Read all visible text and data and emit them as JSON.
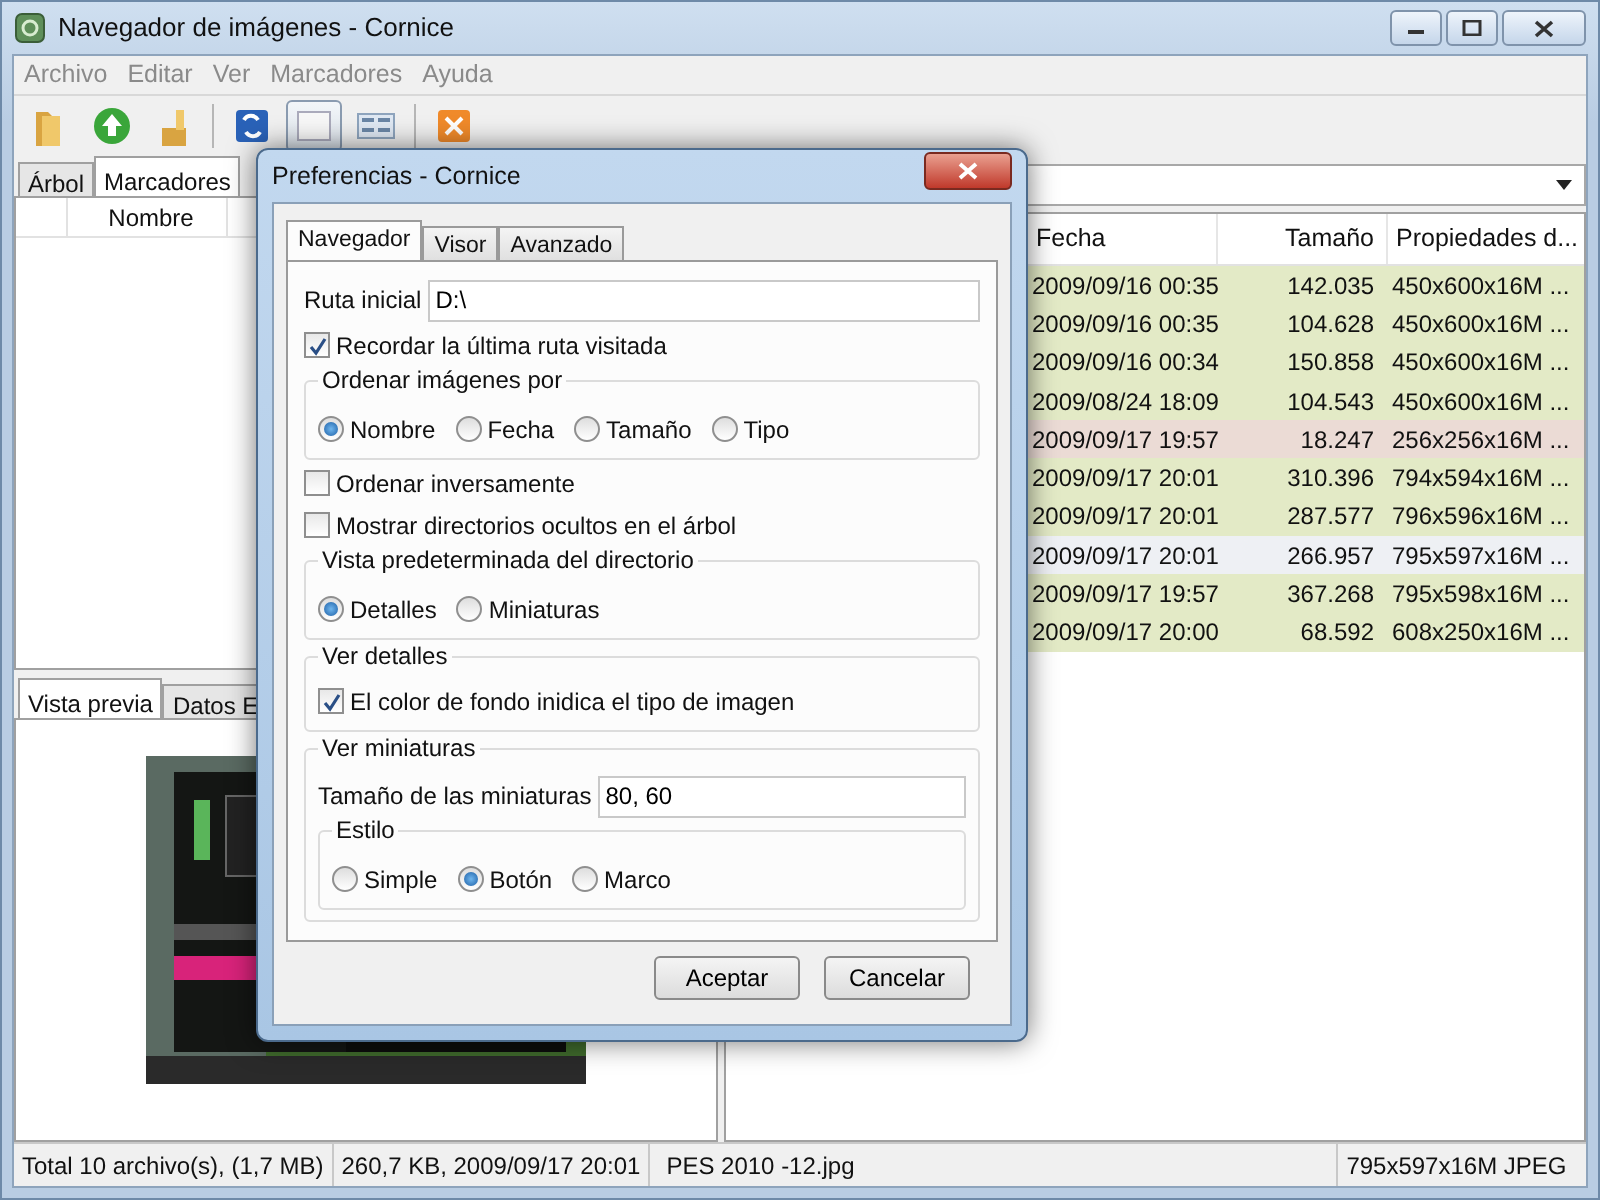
{
  "window": {
    "title": "Navegador de imágenes - Cornice"
  },
  "menu": [
    "Archivo",
    "Editar",
    "Ver",
    "Marcadores",
    "Ayuda"
  ],
  "toolbar": [
    {
      "pressed": false
    },
    {
      "pressed": false
    },
    {
      "pressed": false
    },
    {
      "pressed": false
    },
    {
      "pressed": true
    },
    {
      "pressed": false
    },
    {
      "pressed": false
    }
  ],
  "left_panel": {
    "tabs": [
      {
        "label": "Árbol",
        "selected": false
      },
      {
        "label": "Marcadores",
        "selected": true
      }
    ],
    "columns": [
      "Nombre"
    ]
  },
  "preview_panel": {
    "tabs": [
      {
        "label": "Vista previa",
        "selected": true
      },
      {
        "label": "Datos E",
        "selected": false
      }
    ]
  },
  "file_list": {
    "columns": [
      "Fecha",
      "Tamaño",
      "Propiedades d..."
    ],
    "rows": [
      {
        "cells": [
          "2009/09/16 00:35",
          "142.035",
          "450x600x16M ..."
        ],
        "color": "#e3eac6",
        "selected": false
      },
      {
        "cells": [
          "2009/09/16 00:35",
          "104.628",
          "450x600x16M ..."
        ],
        "color": "#e3eac6",
        "selected": false
      },
      {
        "cells": [
          "2009/09/16 00:34",
          "150.858",
          "450x600x16M ..."
        ],
        "color": "#e3eac6",
        "selected": false
      },
      {
        "cells": [
          "2009/08/24 18:09",
          "104.543",
          "450x600x16M ..."
        ],
        "color": "#e3eac6",
        "selected": false
      },
      {
        "cells": [
          "2009/09/17 19:57",
          "18.247",
          "256x256x16M ..."
        ],
        "color": "#ebdbd5",
        "selected": false
      },
      {
        "cells": [
          "2009/09/17 20:01",
          "310.396",
          "794x594x16M ..."
        ],
        "color": "#e3eac6",
        "selected": false
      },
      {
        "cells": [
          "2009/09/17 20:01",
          "287.577",
          "796x596x16M ..."
        ],
        "color": "#e3eac6",
        "selected": false
      },
      {
        "cells": [
          "2009/09/17 20:01",
          "266.957",
          "795x597x16M ..."
        ],
        "selected": true
      },
      {
        "cells": [
          "2009/09/17 19:57",
          "367.268",
          "795x598x16M ..."
        ],
        "color": "#e3eac6",
        "selected": false
      },
      {
        "cells": [
          "2009/09/17 20:00",
          "68.592",
          "608x250x16M ..."
        ],
        "color": "#e3eac6",
        "selected": false
      }
    ]
  },
  "status_bar": [
    "Total 10 archivo(s), (1,7 MB)",
    "260,7 KB, 2009/09/17 20:01",
    "PES 2010 -12.jpg",
    "795x597x16M JPEG"
  ],
  "dialog": {
    "title": "Preferencias - Cornice",
    "tabs": [
      {
        "label": "Navegador",
        "selected": true
      },
      {
        "label": "Visor",
        "selected": false
      },
      {
        "label": "Avanzado",
        "selected": false
      }
    ],
    "items": [
      {
        "kind": "field",
        "label": "Ruta inicial",
        "value": "D:\\"
      },
      {
        "kind": "checkbox",
        "label": "Recordar la última ruta visitada",
        "checked": true
      },
      {
        "kind": "group",
        "title": "Ordenar imágenes por",
        "items": [
          {
            "kind": "radio",
            "label": "Nombre",
            "selected": true
          },
          {
            "kind": "radio",
            "label": "Fecha",
            "selected": false
          },
          {
            "kind": "radio",
            "label": "Tamaño",
            "selected": false
          },
          {
            "kind": "radio",
            "label": "Tipo",
            "selected": false
          }
        ]
      },
      {
        "kind": "checkbox",
        "label": "Ordenar inversamente",
        "checked": false
      },
      {
        "kind": "checkbox",
        "label": "Mostrar directorios ocultos en el árbol",
        "checked": false
      },
      {
        "kind": "group",
        "title": "Vista predeterminada del directorio",
        "items": [
          {
            "kind": "radio",
            "label": "Detalles",
            "selected": true
          },
          {
            "kind": "radio",
            "label": "Miniaturas",
            "selected": false
          }
        ]
      },
      {
        "kind": "group",
        "title": "Ver detalles",
        "items": [
          {
            "kind": "checkbox",
            "label": "El color de fondo inidica el tipo de imagen",
            "checked": true
          }
        ]
      },
      {
        "kind": "group",
        "title": "Ver miniaturas",
        "items": [
          {
            "kind": "field",
            "label": "Tamaño de las miniaturas",
            "value": "80, 60"
          },
          {
            "kind": "group",
            "title": "Estilo",
            "items": [
              {
                "kind": "radio",
                "label": "Simple",
                "selected": false
              },
              {
                "kind": "radio",
                "label": "Botón",
                "selected": true
              },
              {
                "kind": "radio",
                "label": "Marco",
                "selected": false
              }
            ]
          }
        ]
      }
    ],
    "buttons": [
      "Aceptar",
      "Cancelar"
    ]
  }
}
